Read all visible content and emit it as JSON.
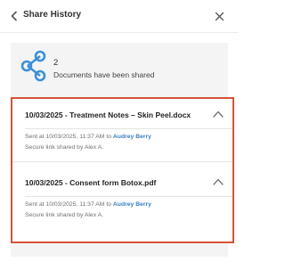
{
  "header": {
    "title": "Share History",
    "back_icon": "chevron-left-icon",
    "close_icon": "close-icon"
  },
  "summary": {
    "count": "2",
    "label": "Documents have been shared",
    "icon": "share-icon",
    "icon_color": "#3b8fd9"
  },
  "shares": [
    {
      "title": "10/03/2025 - Treatment Notes – Skin Peel.docx",
      "sent_prefix": "Sent at 10/03/2025, 11:37 AM to ",
      "recipient": "Audrey Berry",
      "secure_text": "Secure link shared by Alex A."
    },
    {
      "title": "10/03/2025 - Consent form Botox.pdf",
      "sent_prefix": "Sent at 10/03/2025, 11:37 AM to ",
      "recipient": "Audrey Berry",
      "secure_text": "Secure link shared by Alex A."
    }
  ],
  "colors": {
    "accent_link": "#3b7fc0",
    "highlight_border": "#d6523a"
  }
}
